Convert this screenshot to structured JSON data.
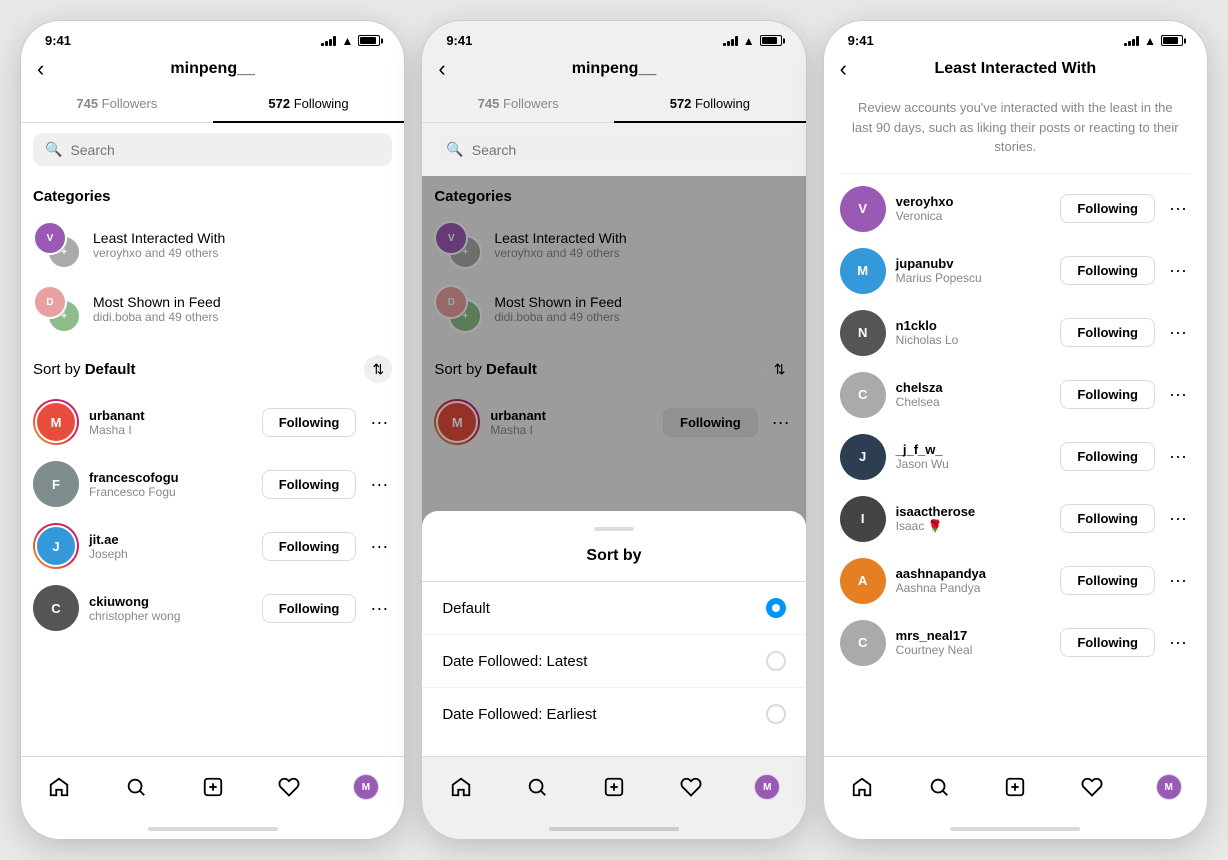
{
  "phone1": {
    "statusTime": "9:41",
    "header": {
      "back": "‹",
      "title": "minpeng__"
    },
    "tabs": [
      {
        "label": "745",
        "sublabel": " Followers",
        "active": false
      },
      {
        "label": "572",
        "sublabel": " Following",
        "active": true
      }
    ],
    "search": {
      "placeholder": "Search"
    },
    "categories": {
      "title": "Categories",
      "items": [
        {
          "name": "Least Interacted With",
          "sub": "veroyhxo and 49 others",
          "color1": "#9b59b6",
          "color2": "#aaa"
        },
        {
          "name": "Most Shown in Feed",
          "sub": "didi.boba and 49 others",
          "color1": "#e8a0a0",
          "color2": "#8fbc8b"
        }
      ]
    },
    "sort": {
      "label": "Sort by ",
      "bold": "Default"
    },
    "users": [
      {
        "handle": "urbanant",
        "name": "Masha I",
        "ring": true,
        "color": "#c0392b"
      },
      {
        "handle": "francescofogu",
        "name": "Francesco Fogu",
        "ring": false,
        "color": "#555"
      },
      {
        "handle": "jit.ae",
        "name": "Joseph",
        "ring": true,
        "color": "#2980b9"
      },
      {
        "handle": "ckiuwong",
        "name": "christopher wong",
        "ring": false,
        "color": "#555"
      }
    ],
    "followingLabel": "Following",
    "nav": {
      "home": "⌂",
      "search": "🔍",
      "add": "➕",
      "heart": "♡",
      "profile_color": "#9b59b6"
    }
  },
  "phone2": {
    "statusTime": "9:41",
    "header": {
      "back": "‹",
      "title": "minpeng__"
    },
    "tabs": [
      {
        "label": "745",
        "sublabel": " Followers",
        "active": false
      },
      {
        "label": "572",
        "sublabel": " Following",
        "active": true
      }
    ],
    "search": {
      "placeholder": "Search"
    },
    "categories": {
      "title": "Categories",
      "items": [
        {
          "name": "Least Interacted With",
          "sub": "veroyhxo and 49 others",
          "color1": "#9b59b6",
          "color2": "#aaa"
        },
        {
          "name": "Most Shown in Feed",
          "sub": "didi.boba and 49 others",
          "color1": "#e8a0a0",
          "color2": "#8fbc8b"
        }
      ]
    },
    "sort": {
      "label": "Sort by ",
      "bold": "Default"
    },
    "users": [
      {
        "handle": "urbanant",
        "name": "Masha I",
        "ring": true,
        "color": "#c0392b"
      }
    ],
    "followingLabel": "Following",
    "sheet": {
      "title": "Sort by",
      "options": [
        {
          "label": "Default",
          "selected": true
        },
        {
          "label": "Date Followed: Latest",
          "selected": false
        },
        {
          "label": "Date Followed: Earliest",
          "selected": false
        }
      ]
    }
  },
  "phone3": {
    "statusTime": "9:41",
    "header": {
      "back": "‹",
      "title": "Least Interacted With"
    },
    "desc": "Review accounts you've interacted with the least in the last 90 days, such as liking their posts or reacting to their stories.",
    "users": [
      {
        "handle": "veroyhxo",
        "name": "Veronica",
        "color": "#9b59b6"
      },
      {
        "handle": "jupanubv",
        "name": "Marius Popescu",
        "color": "#3498db"
      },
      {
        "handle": "n1cklo",
        "name": "Nicholas Lo",
        "color": "#555"
      },
      {
        "handle": "chelsza",
        "name": "Chelsea",
        "color": "#888"
      },
      {
        "handle": "_j_f_w_",
        "name": "Jason Wu",
        "color": "#2c3e50"
      },
      {
        "handle": "isaactherose",
        "name": "Isaac 🌹",
        "color": "#444"
      },
      {
        "handle": "aashnapandya",
        "name": "Aashna Pandya",
        "color": "#e67e22"
      },
      {
        "handle": "mrs_neal17",
        "name": "Courtney Neal",
        "color": "#888"
      }
    ],
    "followingLabel": "Following"
  }
}
